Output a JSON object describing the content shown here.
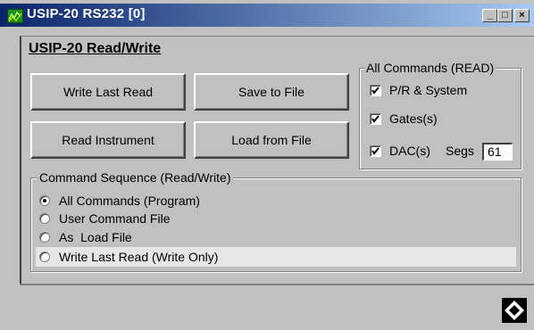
{
  "window": {
    "title": "USIP-20 RS232 [0]",
    "controls": {
      "minimize": "_",
      "maximize": "□",
      "close": "×"
    }
  },
  "section": {
    "title": "USIP-20 Read/Write"
  },
  "buttons": {
    "write_last_read": "Write Last Read",
    "save_to_file": "Save to File",
    "read_instrument": "Read Instrument",
    "load_from_file": "Load from File"
  },
  "all_commands": {
    "label": "All Commands (READ)",
    "items": [
      {
        "label": "P/R & System",
        "checked": true
      },
      {
        "label": "Gates(s)",
        "checked": true
      },
      {
        "label": "DAC(s)",
        "checked": true
      }
    ],
    "segs_label": "Segs",
    "segs_value": "61"
  },
  "command_sequence": {
    "label": "Command Sequence (Read/Write)",
    "options": [
      {
        "label": "All Commands (Program)",
        "selected": true
      },
      {
        "label": "User Command File",
        "selected": false
      },
      {
        "label": "As  Load File",
        "selected": false
      },
      {
        "label": "Write Last Read (Write Only)",
        "selected": false
      }
    ]
  },
  "colors": {
    "titlebar_start": "#0a246a",
    "titlebar_end": "#a6caf0",
    "face": "#c0c0c0",
    "app_icon": "#1f8f1f"
  }
}
